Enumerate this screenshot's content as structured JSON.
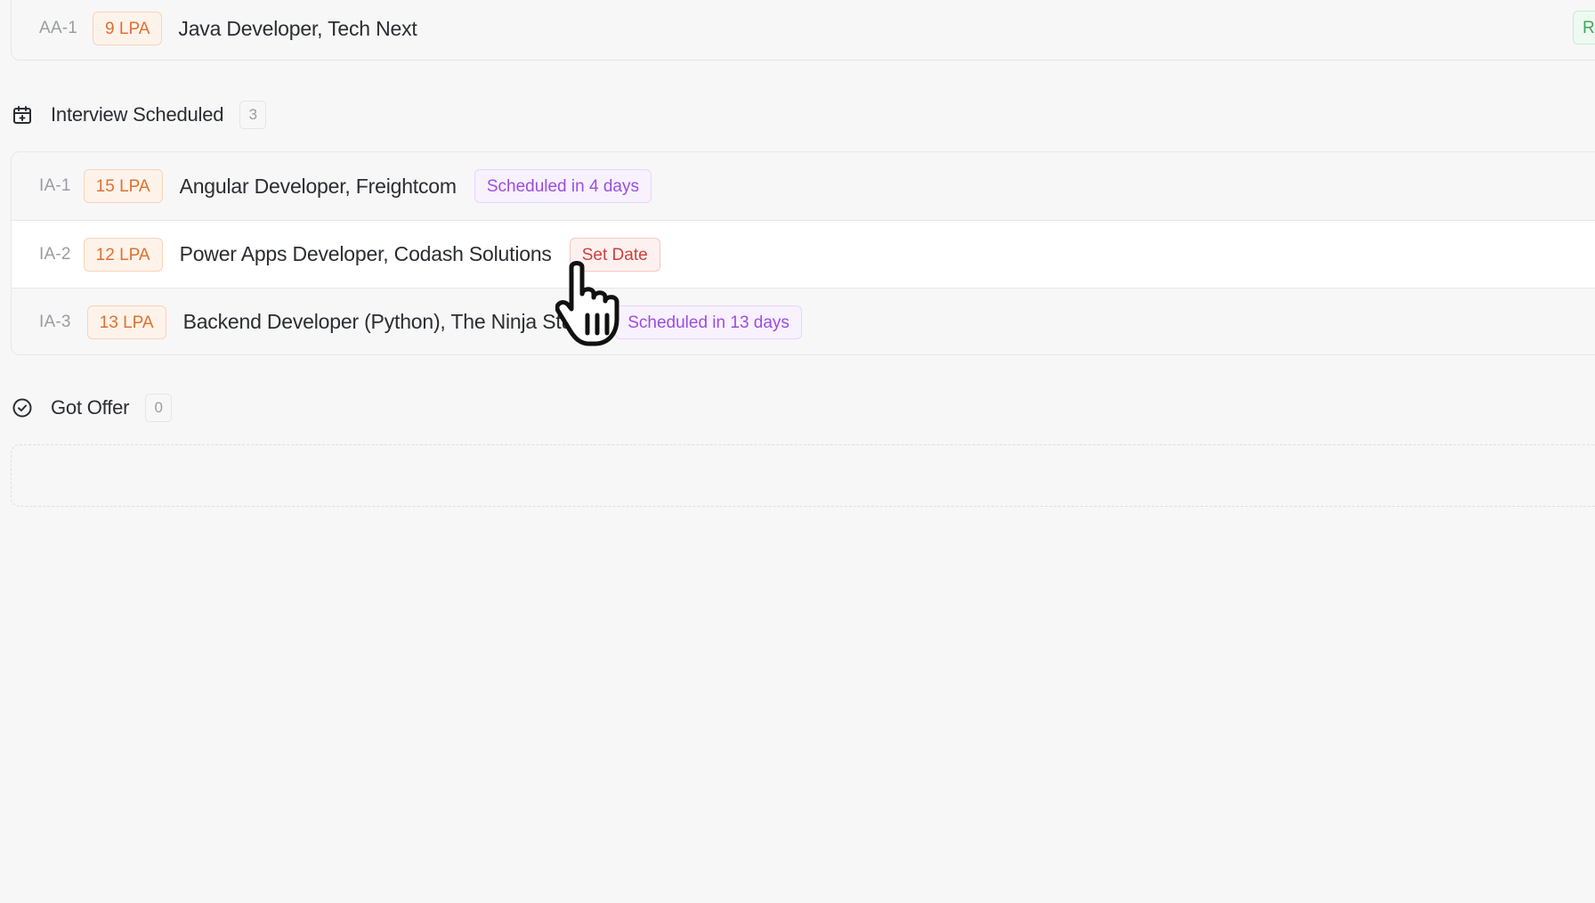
{
  "applied_section": {
    "items": [
      {
        "id": "AA-1",
        "salary": "9 LPA",
        "title": "Java Developer, Tech Next",
        "status": "Rem"
      }
    ]
  },
  "interview_section": {
    "label": "Interview Scheduled",
    "count": "3",
    "items": [
      {
        "id": "IA-1",
        "salary": "15 LPA",
        "title": "Angular Developer, Freightcom",
        "status": "Scheduled in 4 days"
      },
      {
        "id": "IA-2",
        "salary": "12 LPA",
        "title": "Power Apps Developer, Codash Solutions",
        "status": "Set Date"
      },
      {
        "id": "IA-3",
        "salary": "13 LPA",
        "title": "Backend Developer (Python), The Ninja Studio",
        "status": "Scheduled in 13 days"
      }
    ]
  },
  "offer_section": {
    "label": "Got Offer",
    "count": "0"
  },
  "icons": {
    "interview": "calendar-icon",
    "offer": "check-circle-icon",
    "cursor": "hand-pointer-cursor-icon"
  },
  "colors": {
    "salary_text": "#e0702e",
    "scheduled_text": "#9b4ee0",
    "set_date_text": "#cf3f3a",
    "status_green_text": "#3fa65d"
  }
}
